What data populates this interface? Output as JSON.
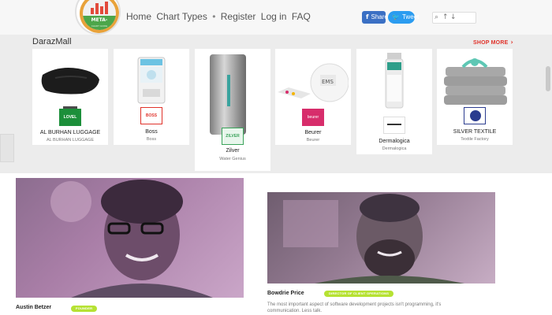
{
  "header": {
    "logo_text": "META-",
    "logo_subtext": "CHART GUIDE",
    "nav": [
      "Home",
      "Chart Types",
      "•",
      "Register",
      "Log in",
      "FAQ"
    ],
    "share": {
      "facebook_label": "Share",
      "twitter_label": "Tweet"
    },
    "search": {
      "placeholder": ""
    }
  },
  "mall": {
    "title": "DarazMall",
    "shop_more": "SHOP MORE",
    "cards": [
      {
        "name": "AL BURHAN LUGGAGE",
        "sub": "AL BURHAN LUGGAGE",
        "brand_badge": "LOVEL",
        "brand_color": "#1c8f3a"
      },
      {
        "name": "Boss",
        "sub": "Boss",
        "brand_badge": "BOSS",
        "brand_color": "#e0322a"
      },
      {
        "name": "Zilver",
        "sub": "Water Genius",
        "brand_badge": "ZILVER",
        "brand_color": "#3aa35a"
      },
      {
        "name": "Beurer",
        "sub": "Beurer",
        "brand_badge": "beurer",
        "brand_color": "#d72d6b"
      },
      {
        "name": "Dermalogica",
        "sub": "Dermalogica",
        "brand_badge": "",
        "brand_color": "#333333"
      },
      {
        "name": "SILVER TEXTILE",
        "sub": "Textile Factory",
        "brand_badge": "",
        "brand_color": "#2b3c8f"
      }
    ]
  },
  "team": {
    "people": [
      {
        "name": "Austin Betzer",
        "role": "FOUNDER"
      },
      {
        "name": "Bowdrie Price",
        "role": "DIRECTOR OF CLIENT OPERATIONS"
      }
    ],
    "quote": "The most important aspect of software development projects isn't programming, it's communication. Less talk."
  },
  "colors": {
    "accent_red": "#e0322a",
    "badge_green": "#b6e233",
    "facebook": "#3b70c4",
    "twitter": "#2b9cf0"
  }
}
